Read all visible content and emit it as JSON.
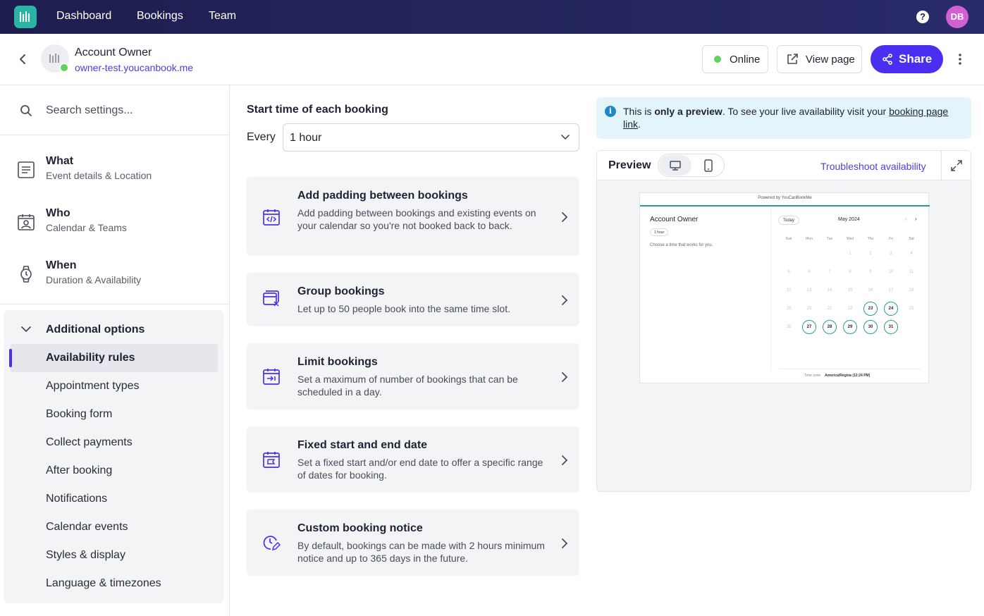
{
  "nav": {
    "items": [
      "Dashboard",
      "Bookings",
      "Team"
    ],
    "help_label": "?",
    "avatar_initials": "DB"
  },
  "header": {
    "account_name": "Account Owner",
    "account_url": "owner-test.youcanbook.me",
    "online_label": "Online",
    "view_page_label": "View page",
    "share_label": "Share"
  },
  "sidebar": {
    "search_placeholder": "Search settings...",
    "main_items": [
      {
        "title": "What",
        "subtitle": "Event details & Location",
        "icon": "list-icon"
      },
      {
        "title": "Who",
        "subtitle": "Calendar & Teams",
        "icon": "calendar-user-icon"
      },
      {
        "title": "When",
        "subtitle": "Duration & Availability",
        "icon": "watch-icon"
      }
    ],
    "additional_title": "Additional options",
    "additional_items": [
      "Availability rules",
      "Appointment types",
      "Booking form",
      "Collect payments",
      "After booking",
      "Notifications",
      "Calendar events",
      "Styles & display",
      "Language & timezones"
    ],
    "active_item": "Availability rules"
  },
  "main": {
    "section_title": "Start time of each booking",
    "every_label": "Every",
    "every_value": "1 hour",
    "cards": [
      {
        "title": "Add padding between bookings",
        "description": "Add padding between bookings and existing events on your calendar so you're not booked back to back.",
        "icon": "calendar-padding-icon"
      },
      {
        "title": "Group bookings",
        "description": "Let up to 50 people book into the same time slot.",
        "icon": "group-icon"
      },
      {
        "title": "Limit bookings",
        "description": "Set a maximum of number of bookings that can be scheduled in a day.",
        "icon": "calendar-limit-icon"
      },
      {
        "title": "Fixed start and end date",
        "description": "Set a fixed start and/or end date to offer a specific range of dates for booking.",
        "icon": "calendar-fixed-icon"
      },
      {
        "title": "Custom booking notice",
        "description": "By default, bookings can be made with 2 hours minimum notice and up to 365 days in the future.",
        "icon": "clock-edit-icon"
      }
    ]
  },
  "info": {
    "part1": "This is ",
    "bold": "only a preview",
    "part2": ". To see your live availability visit your ",
    "link": "booking page link",
    "part3": "."
  },
  "preview": {
    "title": "Preview",
    "troubleshoot_label": "Troubleshoot availability",
    "mini": {
      "powered_by": "Powered by YouCanBookMe",
      "account_name": "Account Owner",
      "duration": "1 hour",
      "choose_text": "Choose a time that works for you.",
      "today_label": "Today",
      "month": "May 2024",
      "weekdays": [
        "Sun",
        "Mon",
        "Tue",
        "Wed",
        "Thu",
        "Fri",
        "Sat"
      ],
      "weeks": [
        [
          "",
          "",
          "",
          "1",
          "2",
          "3",
          "4"
        ],
        [
          "5",
          "6",
          "7",
          "8",
          "9",
          "10",
          "11"
        ],
        [
          "12",
          "13",
          "14",
          "15",
          "16",
          "17",
          "18"
        ],
        [
          "19",
          "20",
          "21",
          "22",
          "23",
          "24",
          "25"
        ],
        [
          "26",
          "27",
          "28",
          "29",
          "30",
          "31",
          ""
        ]
      ],
      "available_days": [
        "23",
        "24",
        "27",
        "28",
        "29",
        "30",
        "31"
      ],
      "timezone_label": "Time zone",
      "timezone_value": "America/Regina (12:24 PM)"
    }
  },
  "colors": {
    "brand": "#4b2ff0",
    "nav_bg": "#1d1e4e",
    "online": "#5fd35b",
    "available": "#2b9c8e"
  }
}
